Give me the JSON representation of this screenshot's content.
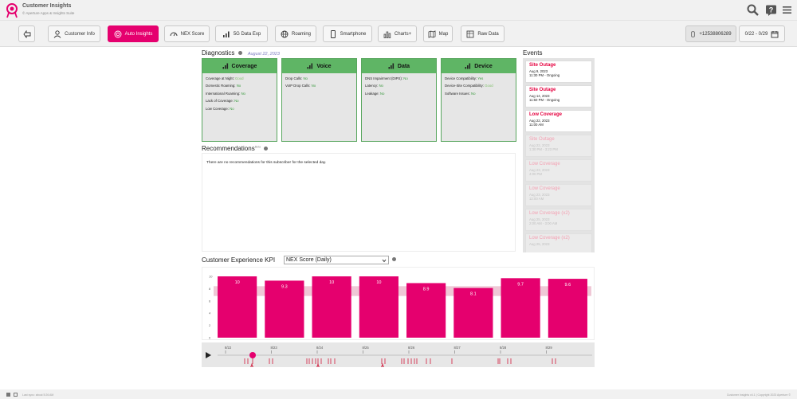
{
  "brand": {
    "title": "Customer Insights",
    "subtitle": "© Aperture Apps & Insights Suite"
  },
  "nav": [
    {
      "label": "",
      "icon": "back-arrow-icon"
    },
    {
      "label": "Customer Info",
      "icon": "user-icon"
    },
    {
      "label": "Auto Insights",
      "icon": "target-icon",
      "active": true
    },
    {
      "label": "NEX Score",
      "icon": "gauge-icon"
    },
    {
      "label": "5G Data Exp",
      "icon": "signal-icon"
    },
    {
      "label": "Roaming",
      "icon": "globe-icon"
    },
    {
      "label": "Smartphone",
      "icon": "smartphone-icon"
    },
    {
      "label": "Charts+",
      "icon": "bar-chart-icon"
    },
    {
      "label": "Map",
      "icon": "map-icon"
    },
    {
      "label": "Raw Data",
      "icon": "table-icon"
    }
  ],
  "phone": "+12538806289",
  "date_range": "0/22 - 0/29",
  "diagnostics": {
    "title": "Diagnostics",
    "date": "August 22, 2023",
    "cards": [
      {
        "name": "Coverage",
        "rows": [
          {
            "label": "Coverage at Night:",
            "value": "Good"
          },
          {
            "label": "Domestic Roaming:",
            "value": "No"
          },
          {
            "label": "International Roaming:",
            "value": "No"
          },
          {
            "label": "Lack of Coverage:",
            "value": "No"
          },
          {
            "label": "Low Coverage:",
            "value": "No"
          }
        ]
      },
      {
        "name": "Voice",
        "rows": [
          {
            "label": "Drop Calls:",
            "value": "No"
          },
          {
            "label": "VoIP Drop Calls:",
            "value": "No"
          }
        ]
      },
      {
        "name": "Data",
        "rows": [
          {
            "label": "DNS Impairment (DIPS):",
            "value": "No"
          },
          {
            "label": "Latency:",
            "value": "No"
          },
          {
            "label": "Leakage:",
            "value": "No"
          }
        ]
      },
      {
        "name": "Device",
        "rows": [
          {
            "label": "Device Compatibility:",
            "value": "Yes"
          },
          {
            "label": "Device-Site Compatibility:",
            "value": "Good"
          },
          {
            "label": "Software Issues:",
            "value": "No"
          }
        ]
      }
    ]
  },
  "recommendations": {
    "title": "Recommendations",
    "sup": "Beta",
    "text": "There are no recommendations for this subscriber for the selected day."
  },
  "events": {
    "title": "Events",
    "items": [
      {
        "title": "Site Outage",
        "date": "Aug 9, 2023",
        "time": "11:30 PM - Ongoing",
        "dim": false
      },
      {
        "title": "Site Outage",
        "date": "Aug 14, 2023",
        "time": "11:50 PM - Ongoing",
        "dim": false
      },
      {
        "title": "Low Coverage",
        "date": "Aug 22, 2023",
        "time": "11:00 AM",
        "dim": false
      },
      {
        "title": "Site Outage",
        "date": "Aug 22, 2023",
        "time": "1:30 PM - 3:23 PM",
        "dim": true
      },
      {
        "title": "Low Coverage",
        "date": "Aug 23, 2023",
        "time": "4:00 PM",
        "dim": true
      },
      {
        "title": "Low Coverage",
        "date": "Aug 23, 2023",
        "time": "12:00 AM",
        "dim": true
      },
      {
        "title": "Low Coverage (x2)",
        "date": "Aug 25, 2023",
        "time": "2:00 AM - 3:00 AM",
        "dim": true
      },
      {
        "title": "Low Coverage (x2)",
        "date": "Aug 25, 2023",
        "time": "",
        "dim": true
      }
    ]
  },
  "kpi": {
    "title": "Customer Experience KPI",
    "selected": "NEX Score (Daily)"
  },
  "chart_data": {
    "type": "bar",
    "categories": [
      "8/22",
      "8/23",
      "8/24",
      "8/25",
      "8/26",
      "8/27",
      "8/28",
      "8/29"
    ],
    "values": [
      10,
      9.3,
      10,
      10,
      8.9,
      8.1,
      9.7,
      9.6
    ],
    "ylim": [
      0,
      10
    ],
    "yticks": [
      "0",
      "2",
      "4",
      "6",
      "8",
      "10"
    ],
    "bar_color": "#e5006e",
    "band_color": "#efc8d6"
  },
  "timeline": {
    "labels": [
      "8/22",
      "8/23",
      "8/24",
      "8/25",
      "8/26",
      "8/27",
      "8/28",
      "8/29"
    ],
    "accent": "#e5006e",
    "marker_color": "#d01a3a"
  },
  "status": {
    "left": "Last sync: about 5:26 AM",
    "right": "Customer Insights v4.1 | Copyright 2023 Aperture ©"
  }
}
